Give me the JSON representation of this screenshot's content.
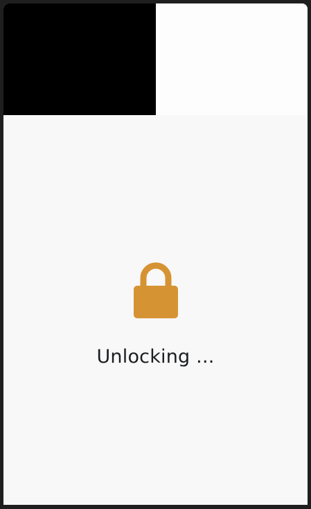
{
  "unlock_screen": {
    "status_text": "Unlocking ...",
    "icon": "lock-icon",
    "accent_color": "#d69334"
  }
}
